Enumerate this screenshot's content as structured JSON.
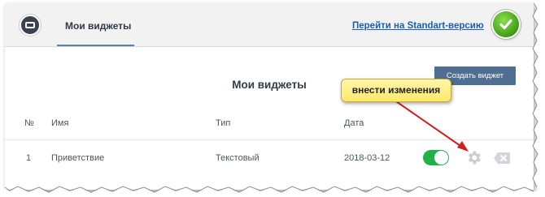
{
  "header": {
    "active_tab": "Мои виджеты",
    "standart_link": "Перейти на Standart-версию"
  },
  "main": {
    "create_button": "Создать виджет",
    "title": "Мои виджеты",
    "columns": [
      "№",
      "Имя",
      "Тип",
      "Дата"
    ],
    "rows": [
      {
        "num": "1",
        "name": "Приветствие",
        "type": "Текстовый",
        "date": "2018-03-12",
        "enabled": true
      }
    ]
  },
  "annotation": {
    "callout_text": "внести изменения"
  },
  "colors": {
    "primary_button": "#4f6e91",
    "toggle_on": "#21b14a",
    "link": "#1a5fb4",
    "callout_bg": "#ffe96a",
    "arrow": "#cc1f1f"
  },
  "icons": [
    "logo-icon",
    "green-check-icon",
    "gear-icon",
    "delete-icon"
  ]
}
